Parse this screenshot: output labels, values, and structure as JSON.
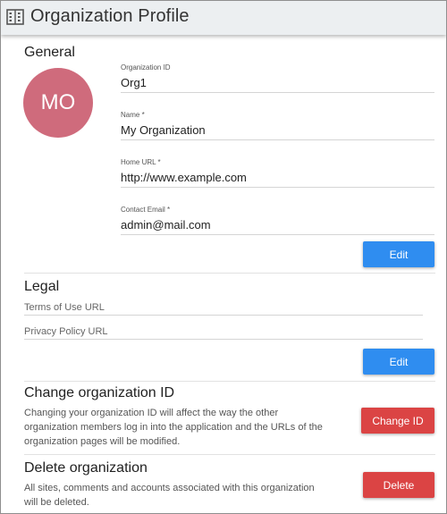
{
  "header": {
    "title": "Organization Profile",
    "icon": "building-icon"
  },
  "general": {
    "title": "General",
    "avatar_initials": "MO",
    "avatar_color": "#cf6b7c",
    "fields": [
      {
        "label": "Organization ID",
        "value": "Org1"
      },
      {
        "label": "Name *",
        "value": "My Organization"
      },
      {
        "label": "Home URL *",
        "value": "http://www.example.com"
      },
      {
        "label": "Contact Email *",
        "value": "admin@mail.com"
      }
    ],
    "edit_label": "Edit"
  },
  "legal": {
    "title": "Legal",
    "terms_placeholder": "Terms of Use URL",
    "privacy_placeholder": "Privacy Policy URL",
    "edit_label": "Edit"
  },
  "change_id": {
    "title": "Change organization ID",
    "description": "Changing your organization ID will affect the way the other organization members log in into the application and the URLs of the organization pages will be modified.",
    "button_label": "Change ID"
  },
  "delete_org": {
    "title": "Delete organization",
    "description": "All sites, comments and accounts associated with this organization will be deleted.",
    "button_label": "Delete"
  },
  "colors": {
    "primary": "#2f8df0",
    "danger": "#db4444",
    "header_bg": "#eceff1"
  }
}
